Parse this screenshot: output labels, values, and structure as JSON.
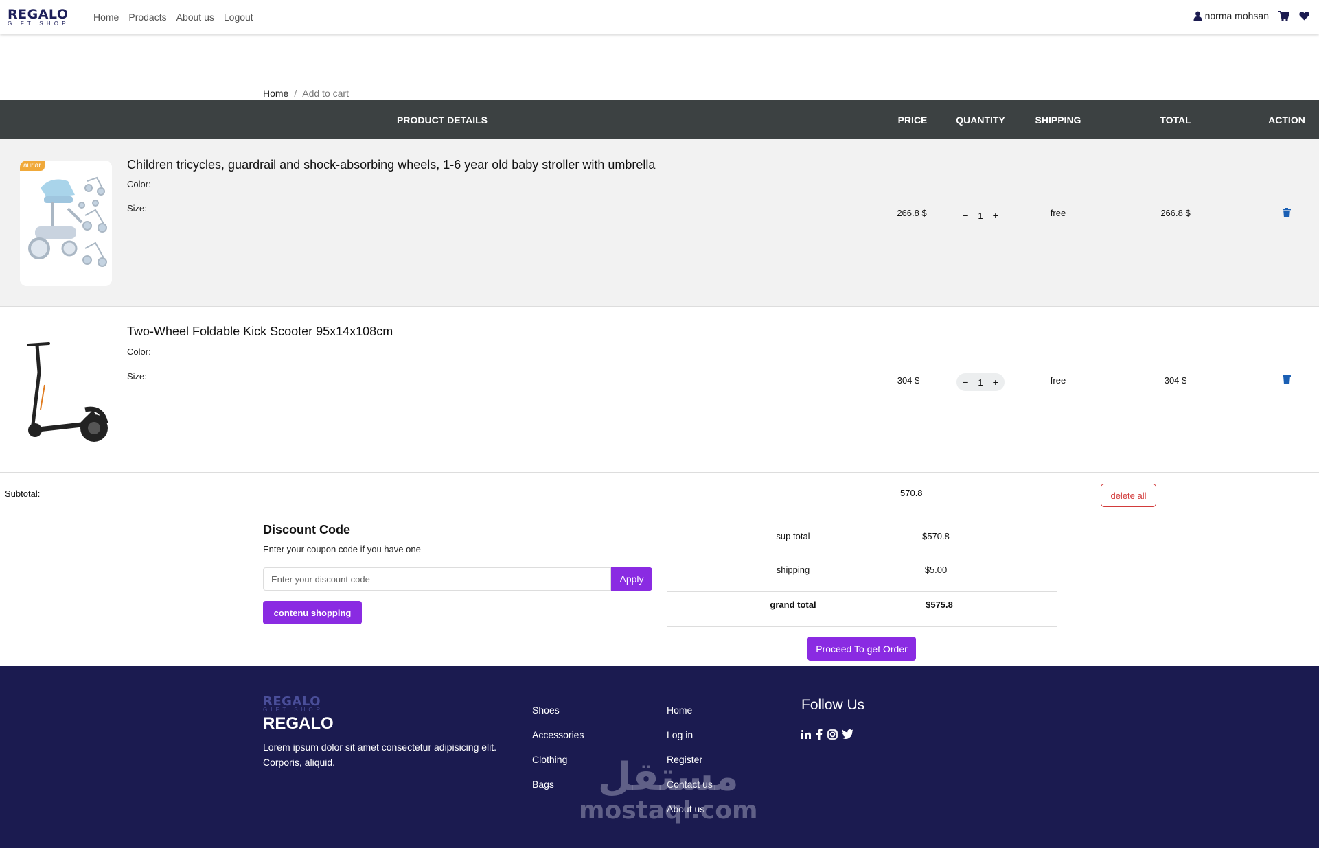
{
  "navbar": {
    "logo_main": "REGALO",
    "logo_sub": "GIFT SHOP",
    "links": [
      "Home",
      "Prodacts",
      "About us",
      "Logout"
    ],
    "user_name": "norma mohsan",
    "icons": [
      "user-icon",
      "cart-icon",
      "heart-icon"
    ]
  },
  "breadcrumb": {
    "home": "Home",
    "sep": "/",
    "current": "Add to cart"
  },
  "table": {
    "headers": [
      "PRODUCT DETAILS",
      "PRICE",
      "QUANTITY",
      "SHIPPING",
      "TOTAL",
      "ACTION"
    ],
    "rows": [
      {
        "badge": "aurlar",
        "name": "Children tricycles, guardrail and shock-absorbing wheels, 1-6 year old baby stroller with umbrella",
        "color_label": "Color:",
        "size_label": "Size:",
        "price": "266.8 $",
        "qty": "1",
        "minus": "−",
        "plus": "+",
        "shipping": "free",
        "total": "266.8 $"
      },
      {
        "name": "Two-Wheel Foldable Kick Scooter 95x14x108cm",
        "color_label": "Color:",
        "size_label": "Size:",
        "price": "304 $",
        "qty": "1",
        "minus": "−",
        "plus": "+",
        "shipping": "free",
        "total": "304 $"
      }
    ]
  },
  "subtotal": {
    "label": "Subtotal:",
    "value": "570.8",
    "delete_all": "delete all"
  },
  "discount": {
    "title": "Discount Code",
    "subtitle": "Enter your coupon code if you have one",
    "placeholder": "Enter your discount code",
    "apply": "Apply",
    "continue": "contenu shopping"
  },
  "summary": {
    "sup_total_label": "sup total",
    "sup_total_value": "$570.8",
    "shipping_label": "shipping",
    "shipping_value": "$5.00",
    "grand_total_label": "grand total",
    "grand_total_value": "$575.8",
    "proceed": "Proceed To get Order"
  },
  "footer": {
    "logo_main": "REGALO",
    "logo_sub": "GIFT SHOP",
    "brand": "REGALO",
    "description": "Lorem ipsum dolor sit amet consectetur adipisicing elit. Corporis, aliquid.",
    "col1": [
      "Shoes",
      "Accessories",
      "Clothing",
      "Bags"
    ],
    "col2": [
      "Home",
      "Log in",
      "Register",
      "Contact us",
      "About us"
    ],
    "follow_title": "Follow Us",
    "socials": [
      "linkedin-icon",
      "facebook-icon",
      "instagram-icon",
      "twitter-icon"
    ],
    "watermark_ar": "مستقل",
    "watermark_lat": "mostaql.com"
  },
  "colors": {
    "navy": "#1b1b50",
    "purple": "#8a2be2",
    "header_bg": "#3c4142",
    "danger": "#d23b3b",
    "trash": "#1a5fb4",
    "badge": "#f0a93a"
  }
}
